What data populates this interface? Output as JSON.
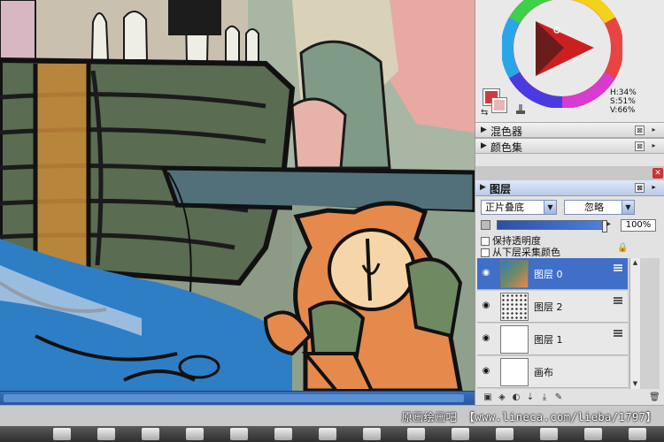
{
  "colors": {
    "main_color": "#cd3b3b",
    "sub_color": "#e8b4b4",
    "selection_blue": "#3f6fc6"
  },
  "color_panel": {
    "hsv": [
      "H:34%",
      "S:51%",
      "V:66%"
    ]
  },
  "panels": {
    "color_mixer": {
      "label": "混色器"
    },
    "color_set": {
      "label": "颜色集"
    }
  },
  "layers": {
    "title": "图层",
    "blend_mode": "正片叠底",
    "mode_option": "忽略",
    "opacity": "100%",
    "options": [
      "保持透明度",
      "从下层采集颜色"
    ],
    "items": [
      {
        "name": "图层 0",
        "selected": true
      },
      {
        "name": "图层 2",
        "selected": false
      },
      {
        "name": "图层 1",
        "selected": false
      },
      {
        "name": "画布",
        "selected": false
      }
    ]
  },
  "watermark": {
    "text": "原画绘画吧 【www.lineca.com/lieba/1797】"
  },
  "icons": {
    "panel_collapse": "triangle-right-icon",
    "panel_close": "close-icon",
    "visibility": "eye-icon",
    "lock": "lock-icon"
  }
}
